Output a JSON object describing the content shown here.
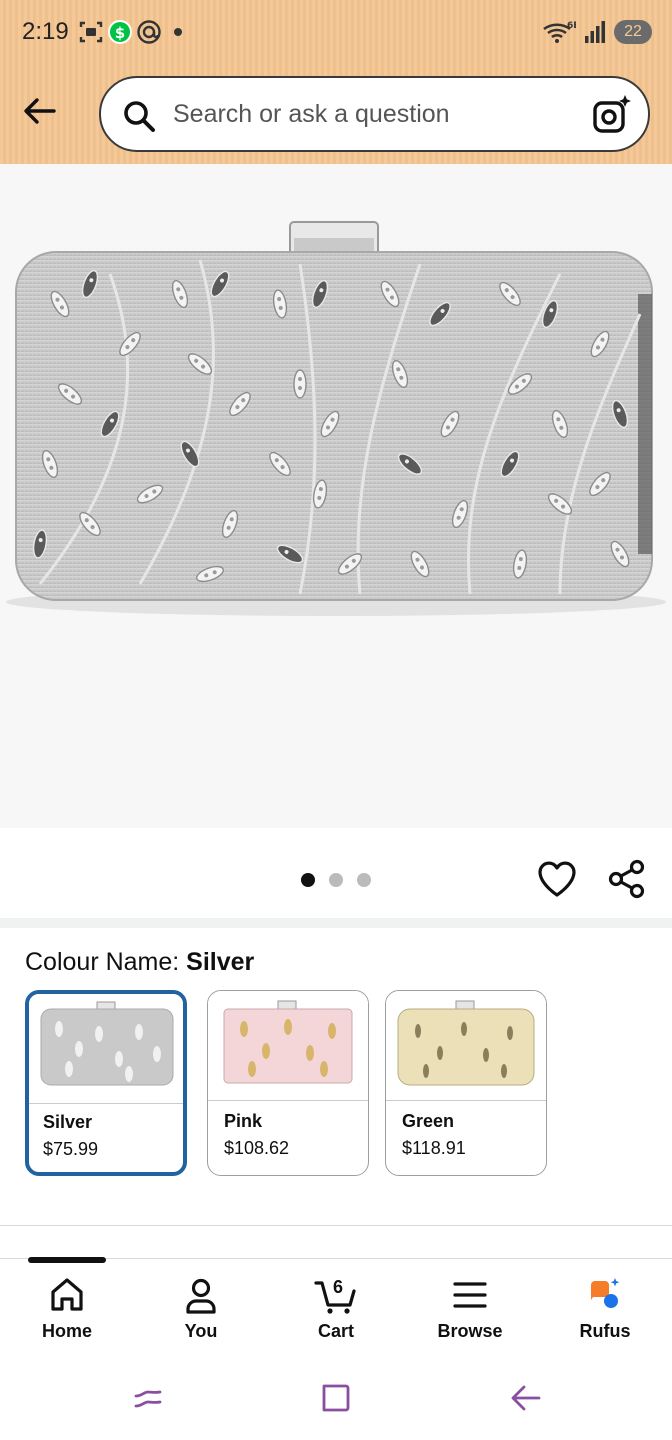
{
  "status_bar": {
    "time": "2:19",
    "network": "6E",
    "battery": "22",
    "icons": [
      "screenshot-icon",
      "cash-app-icon",
      "at-sign-icon",
      "notification-dot-icon",
      "wifi-icon",
      "signal-icon",
      "battery-icon"
    ]
  },
  "header": {
    "search_placeholder": "Search or ask a question",
    "icons": [
      "back-arrow-icon",
      "search-icon",
      "camera-lens-icon"
    ]
  },
  "product_image": {
    "carousel_count": 3,
    "active_index": 0
  },
  "colour": {
    "label": "Colour Name: ",
    "selected": "Silver",
    "options": [
      {
        "name": "Silver",
        "price": "$75.99",
        "color": "#c9c9c9"
      },
      {
        "name": "Pink",
        "price": "$108.62",
        "color": "#f4d6d8"
      },
      {
        "name": "Green",
        "price": "$118.91",
        "color": "#ece0b8"
      }
    ]
  },
  "bottom_nav": {
    "items": [
      {
        "label": "Home",
        "icon": "home-icon"
      },
      {
        "label": "You",
        "icon": "person-icon"
      },
      {
        "label": "Cart",
        "icon": "cart-icon",
        "count": "6"
      },
      {
        "label": "Browse",
        "icon": "menu-icon"
      },
      {
        "label": "Rufus",
        "icon": "rufus-icon"
      }
    ]
  },
  "colors": {
    "header_bg": "#f4c99a",
    "selected_border": "#2162a1",
    "accent_orange": "#f57c29",
    "accent_blue": "#1a73e8",
    "system_nav": "#8a4fa0"
  }
}
